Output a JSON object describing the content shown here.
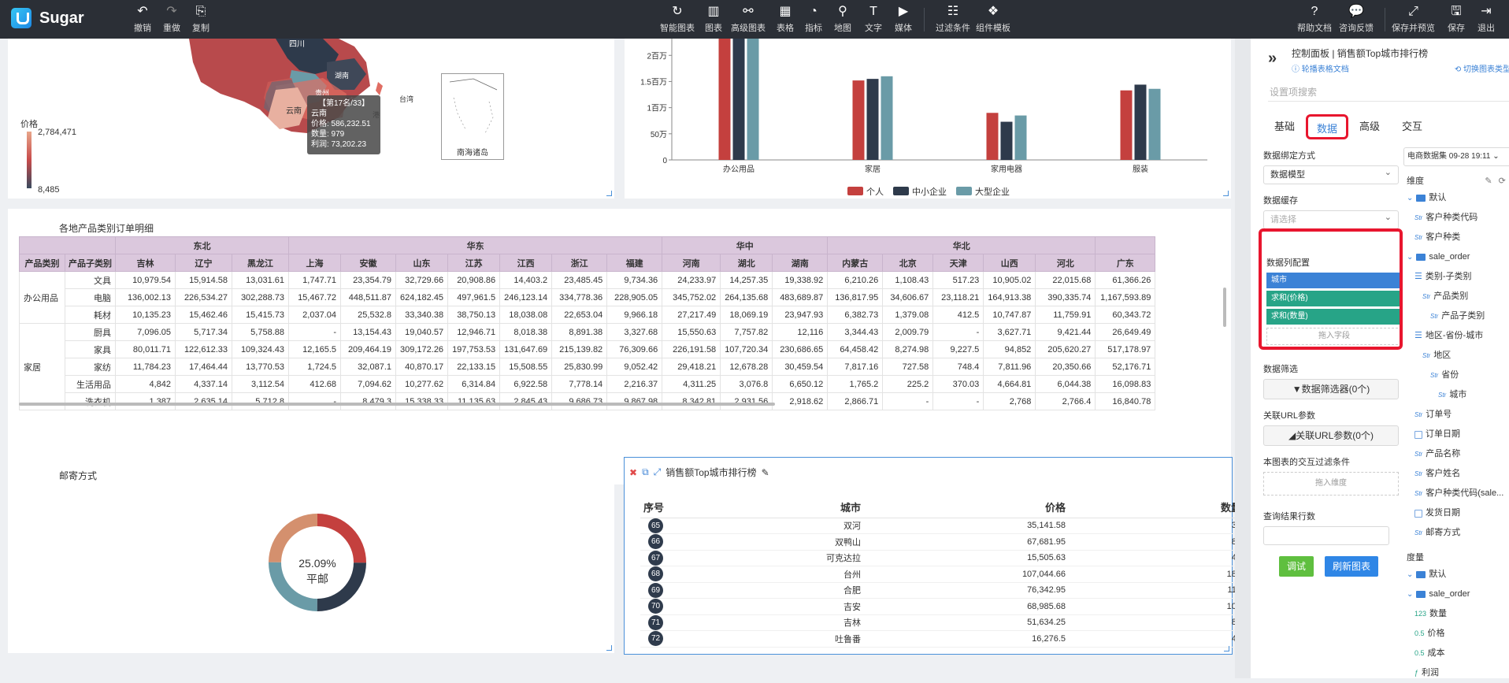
{
  "app": {
    "name": "Sugar"
  },
  "toolbar": {
    "left": [
      {
        "label": "撤销",
        "icon": "undo-icon"
      },
      {
        "label": "重做",
        "icon": "redo-icon"
      },
      {
        "label": "复制",
        "icon": "copy-icon"
      }
    ],
    "center": [
      {
        "label": "智能图表",
        "icon": "smart-chart-icon"
      },
      {
        "label": "图表",
        "icon": "chart-icon"
      },
      {
        "label": "高级图表",
        "icon": "advanced-chart-icon"
      },
      {
        "label": "表格",
        "icon": "table-icon"
      },
      {
        "label": "指标",
        "icon": "gauge-icon"
      },
      {
        "label": "地图",
        "icon": "map-icon"
      },
      {
        "label": "文字",
        "icon": "text-icon"
      },
      {
        "label": "媒体",
        "icon": "media-icon"
      },
      {
        "label": "过滤条件",
        "icon": "filter-icon"
      },
      {
        "label": "组件模板",
        "icon": "template-icon"
      }
    ],
    "right": [
      {
        "label": "帮助文档",
        "icon": "help-icon"
      },
      {
        "label": "咨询反馈",
        "icon": "feedback-icon"
      },
      {
        "label": "保存并预览",
        "icon": "expand-icon"
      },
      {
        "label": "保存",
        "icon": "save-icon"
      },
      {
        "label": "退出",
        "icon": "exit-icon"
      }
    ]
  },
  "map": {
    "legend_title": "价格",
    "legend_max": "2,784,471",
    "legend_min": "8,485",
    "places": [
      "四川",
      "云南",
      "贵州",
      "湖南",
      "广西",
      "台湾",
      "港"
    ],
    "tooltip": {
      "title": "【第17名/33】",
      "lines": [
        "云南",
        "价格: 586,232.51",
        "数量: 979",
        "利润: 73,202.23"
      ]
    },
    "inset_label": "南海诸岛"
  },
  "bar_chart": {
    "chart_data": {
      "type": "bar",
      "categories": [
        "办公用品",
        "家居",
        "家用电器",
        "服装"
      ],
      "series": [
        {
          "name": "个人",
          "values": [
            2400000,
            1520000,
            900000,
            1330000
          ],
          "color": "#c4403e"
        },
        {
          "name": "中小企业",
          "values": [
            2400000,
            1550000,
            730000,
            1440000
          ],
          "color": "#2e3a4b"
        },
        {
          "name": "大型企业",
          "values": [
            2400000,
            1600000,
            850000,
            1360000
          ],
          "color": "#6a9ba7"
        }
      ],
      "yticks": [
        "0",
        "50万",
        "1百万",
        "1.5百万",
        "2百万"
      ],
      "ylim": [
        0,
        2200000
      ],
      "legend_position": "bottom"
    }
  },
  "pivot": {
    "title": "各地产品类别订单明细",
    "regions": [
      {
        "name": "",
        "span": 2
      },
      {
        "name": "东北",
        "span": 3
      },
      {
        "name": "华东",
        "span": 7
      },
      {
        "name": "华中",
        "span": 3
      },
      {
        "name": "华北",
        "span": 5
      },
      {
        "name": "",
        "span": 1
      }
    ],
    "columns": [
      "产品类别",
      "产品子类别",
      "吉林",
      "辽宁",
      "黑龙江",
      "上海",
      "安徽",
      "山东",
      "江苏",
      "江西",
      "浙江",
      "福建",
      "河南",
      "湖北",
      "湖南",
      "内蒙古",
      "北京",
      "天津",
      "山西",
      "河北",
      "广东"
    ],
    "groups": [
      {
        "category": "办公用品",
        "rows": [
          [
            "文具",
            "10,979.54",
            "15,914.58",
            "13,031.61",
            "1,747.71",
            "23,354.79",
            "32,729.66",
            "20,908.86",
            "14,403.2",
            "23,485.45",
            "9,734.36",
            "24,233.97",
            "14,257.35",
            "19,338.92",
            "6,210.26",
            "1,108.43",
            "517.23",
            "10,905.02",
            "22,015.68",
            "61,366.26"
          ],
          [
            "电脑",
            "136,002.13",
            "226,534.27",
            "302,288.73",
            "15,467.72",
            "448,511.87",
            "624,182.45",
            "497,961.5",
            "246,123.14",
            "334,778.36",
            "228,905.05",
            "345,752.02",
            "264,135.68",
            "483,689.87",
            "136,817.95",
            "34,606.67",
            "23,118.21",
            "164,913.38",
            "390,335.74",
            "1,167,593.89"
          ],
          [
            "耗材",
            "10,135.23",
            "15,462.46",
            "15,415.73",
            "2,037.04",
            "25,532.8",
            "33,340.38",
            "38,750.13",
            "18,038.08",
            "22,653.04",
            "9,966.18",
            "27,217.49",
            "18,069.19",
            "23,947.93",
            "6,382.73",
            "1,379.08",
            "412.5",
            "10,747.87",
            "11,759.91",
            "60,343.72"
          ]
        ]
      },
      {
        "category": "家居",
        "rows": [
          [
            "厨具",
            "7,096.05",
            "5,717.34",
            "5,758.88",
            "-",
            "13,154.43",
            "19,040.57",
            "12,946.71",
            "8,018.38",
            "8,891.38",
            "3,327.68",
            "15,550.63",
            "7,757.82",
            "12,116",
            "3,344.43",
            "2,009.79",
            "-",
            "3,627.71",
            "9,421.44",
            "26,649.49"
          ],
          [
            "家具",
            "80,011.71",
            "122,612.33",
            "109,324.43",
            "12,165.5",
            "209,464.19",
            "309,172.26",
            "197,753.53",
            "131,647.69",
            "215,139.82",
            "76,309.66",
            "226,191.58",
            "107,720.34",
            "230,686.65",
            "64,458.42",
            "8,274.98",
            "9,227.5",
            "94,852",
            "205,620.27",
            "517,178.97"
          ],
          [
            "家纺",
            "11,784.23",
            "17,464.44",
            "13,770.53",
            "1,724.5",
            "32,087.1",
            "40,870.17",
            "22,133.15",
            "15,508.55",
            "25,830.99",
            "9,052.42",
            "29,418.21",
            "12,678.28",
            "30,459.54",
            "7,817.16",
            "727.58",
            "748.4",
            "7,811.96",
            "20,350.66",
            "52,176.71"
          ],
          [
            "生活用品",
            "4,842",
            "4,337.14",
            "3,112.54",
            "412.68",
            "7,094.62",
            "10,277.62",
            "6,314.84",
            "6,922.58",
            "7,778.14",
            "2,216.37",
            "4,311.25",
            "3,076.8",
            "6,650.12",
            "1,765.2",
            "225.2",
            "370.03",
            "4,664.81",
            "6,044.38",
            "16,098.83"
          ],
          [
            "洗衣机",
            "1,387",
            "2,635.14",
            "5,712.8",
            "-",
            "8,479.3",
            "15,338.33",
            "11,135.63",
            "2,845.43",
            "9,686.73",
            "9,867.98",
            "8,342.81",
            "2,931.56",
            "2,918.62",
            "2,866.71",
            "-",
            "-",
            "2,768",
            "2,766.4",
            "16,840.78"
          ]
        ]
      }
    ]
  },
  "donut": {
    "title": "邮寄方式",
    "center_value": "25.09%",
    "center_label": "平邮",
    "chart_data": {
      "type": "pie",
      "slices": [
        {
          "value": 25.09,
          "color": "#c4403e"
        },
        {
          "value": 25,
          "color": "#2e3a4b"
        },
        {
          "value": 25,
          "color": "#6a9ba7"
        },
        {
          "value": 24.91,
          "color": "#d4906e"
        }
      ]
    }
  },
  "ranking": {
    "title": "销售额Top城市排行榜",
    "headers": [
      "序号",
      "城市",
      "价格",
      "数量"
    ],
    "rows": [
      [
        "65",
        "双河",
        "35,141.58",
        "39"
      ],
      [
        "66",
        "双鸭山",
        "67,681.95",
        "86"
      ],
      [
        "67",
        "可克达拉",
        "15,505.63",
        "42"
      ],
      [
        "68",
        "台州",
        "107,044.66",
        "182"
      ],
      [
        "69",
        "合肥",
        "76,342.95",
        "119"
      ],
      [
        "70",
        "吉安",
        "68,985.68",
        "109"
      ],
      [
        "71",
        "吉林",
        "51,634.25",
        "88"
      ],
      [
        "72",
        "吐鲁番",
        "16,276.5",
        "42"
      ]
    ]
  },
  "panel": {
    "header": "控制面板 | 销售额Top城市排行榜",
    "doc_link": "轮播表格文档",
    "switch_type": "切换图表类型",
    "search_placeholder": "设置项搜索",
    "tabs": [
      "基础",
      "数据",
      "高级",
      "交互"
    ],
    "bind_label": "数据绑定方式",
    "bind_value": "数据模型",
    "cache_label": "数据缓存",
    "cache_placeholder": "请选择",
    "datacol_label": "数据列配置",
    "datacols": [
      "城市",
      "求和(价格)",
      "求和(数量)"
    ],
    "drop_field": "拖入字段",
    "filter_label": "数据筛选",
    "filter_button": "数据筛选器(0个)",
    "url_label": "关联URL参数",
    "url_button": "关联URL参数(0个)",
    "interaction_label": "本图表的交互过滤条件",
    "drop_dimension": "拖入维度",
    "rows_label": "查询结果行数",
    "debug_button": "调试",
    "refresh_button": "刷新图表",
    "dataset": "电商数据集 09-28 19:11",
    "dimension_title": "维度",
    "measure_title": "度量",
    "dimensions": [
      {
        "kind": "folder",
        "text": "默认",
        "indent": 0
      },
      {
        "kind": "str",
        "text": "客户种类代码",
        "indent": 1
      },
      {
        "kind": "str",
        "text": "客户种类",
        "indent": 1
      },
      {
        "kind": "folder",
        "text": "sale_order",
        "indent": 0
      },
      {
        "kind": "hier",
        "text": "类别-子类别",
        "indent": 1
      },
      {
        "kind": "str",
        "text": "产品类别",
        "indent": 2
      },
      {
        "kind": "str",
        "text": "产品子类别",
        "indent": 3
      },
      {
        "kind": "hier",
        "text": "地区-省份-城市",
        "indent": 1
      },
      {
        "kind": "str",
        "text": "地区",
        "indent": 2
      },
      {
        "kind": "str",
        "text": "省份",
        "indent": 3
      },
      {
        "kind": "str",
        "text": "城市",
        "indent": 4
      },
      {
        "kind": "str",
        "text": "订单号",
        "indent": 1
      },
      {
        "kind": "date",
        "text": "订单日期",
        "indent": 1
      },
      {
        "kind": "str",
        "text": "产品名称",
        "indent": 1
      },
      {
        "kind": "str",
        "text": "客户姓名",
        "indent": 1
      },
      {
        "kind": "str",
        "text": "客户种类代码(sale...",
        "indent": 1
      },
      {
        "kind": "date",
        "text": "发货日期",
        "indent": 1
      },
      {
        "kind": "str",
        "text": "邮寄方式",
        "indent": 1
      }
    ],
    "measures": [
      {
        "kind": "folder",
        "text": "默认",
        "indent": 0
      },
      {
        "kind": "folder",
        "text": "sale_order",
        "indent": 0
      },
      {
        "kind": "int",
        "text": "数量",
        "indent": 1
      },
      {
        "kind": "dec",
        "text": "价格",
        "indent": 1
      },
      {
        "kind": "dec",
        "text": "成本",
        "indent": 1
      },
      {
        "kind": "calc",
        "text": "利润",
        "indent": 1
      }
    ]
  }
}
